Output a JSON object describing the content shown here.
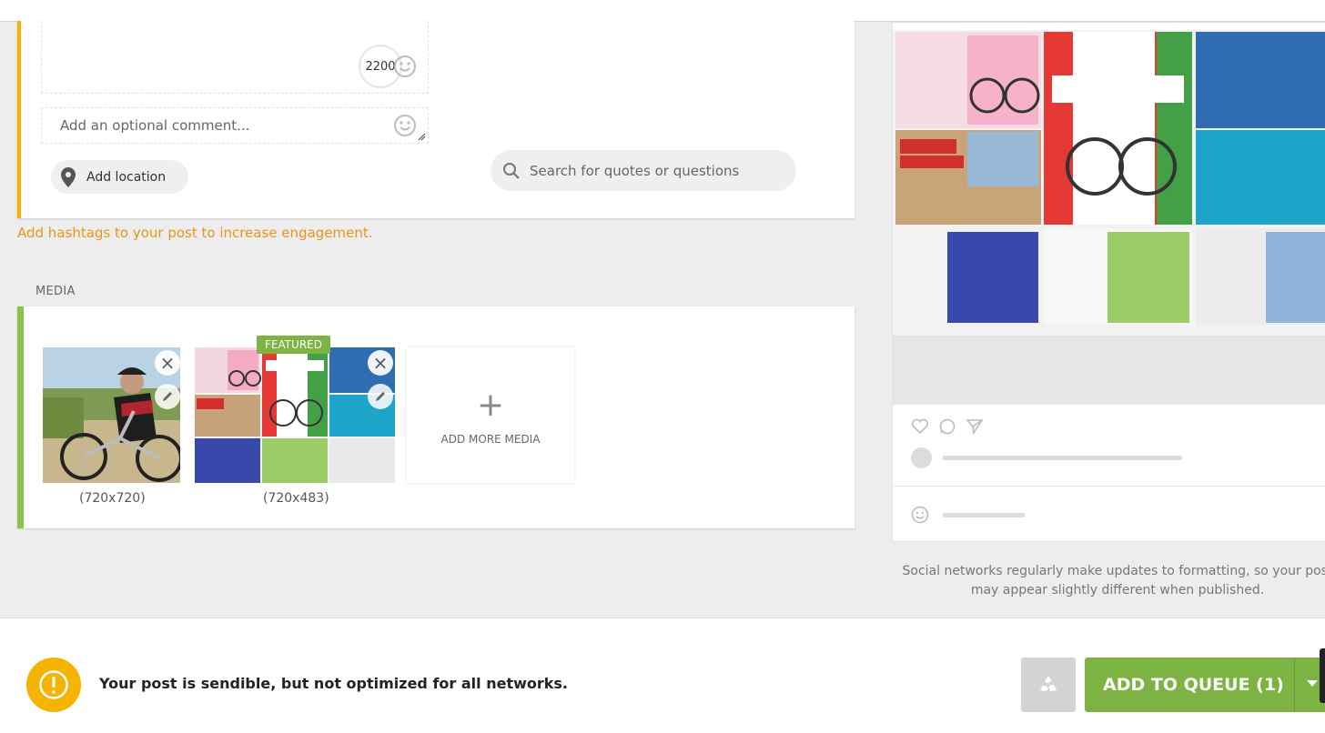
{
  "composer": {
    "char_counter": "2200",
    "comment_placeholder": "Add an optional comment...",
    "add_location_label": "Add location",
    "search_placeholder": "Search for quotes or questions"
  },
  "hashtag_hint": "Add hashtags to your post to increase engagement.",
  "media": {
    "section_label": "MEDIA",
    "items": [
      {
        "dimensions": "(720x720)",
        "description": "cyclist-photo"
      },
      {
        "dimensions": "(720x483)",
        "description": "magazine-spread",
        "badge": "FEATURED"
      }
    ],
    "add_more_label": "ADD MORE MEDIA"
  },
  "preview": {
    "note_line1": "Social networks regularly make updates to formatting, so your post",
    "note_line2": "may appear slightly different when published."
  },
  "footer": {
    "warning_text": "Your post is sendible, but not optimized for all networks.",
    "queue_button_label": "ADD TO QUEUE (1)"
  },
  "colors": {
    "accent_green": "#7cb342",
    "warning_yellow": "#f5b400",
    "hint_orange": "#e8961a"
  }
}
